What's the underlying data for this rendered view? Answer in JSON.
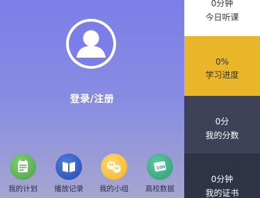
{
  "profile": {
    "login_label": "登录/注册",
    "avatar_icon": "user-avatar-icon"
  },
  "shortcuts": [
    {
      "label": "我的计划",
      "icon": "calendar-icon",
      "color": "#5fb057"
    },
    {
      "label": "播放记录",
      "icon": "open-book-icon",
      "color": "#2f56c0"
    },
    {
      "label": "我的小组",
      "icon": "group-faces-icon",
      "color": "#f6c23d"
    },
    {
      "label": "高校数据",
      "icon": "score-card-icon",
      "color": "#3cb088"
    }
  ],
  "stats": {
    "listen": {
      "value": "0分钟",
      "label": "今日听课"
    },
    "progress": {
      "value": "0%",
      "label": "学习进度"
    },
    "score": {
      "value": "0分",
      "label": "我的分数"
    },
    "certificate": {
      "value": "0分钟",
      "label": "我的证书"
    }
  },
  "colors": {
    "panel_top": "#7b7ee8",
    "panel_bottom": "#a6a6cf",
    "progress_tile": "#eab629",
    "score_tile": "#3d4257",
    "certificate_tile": "#2f3346"
  }
}
